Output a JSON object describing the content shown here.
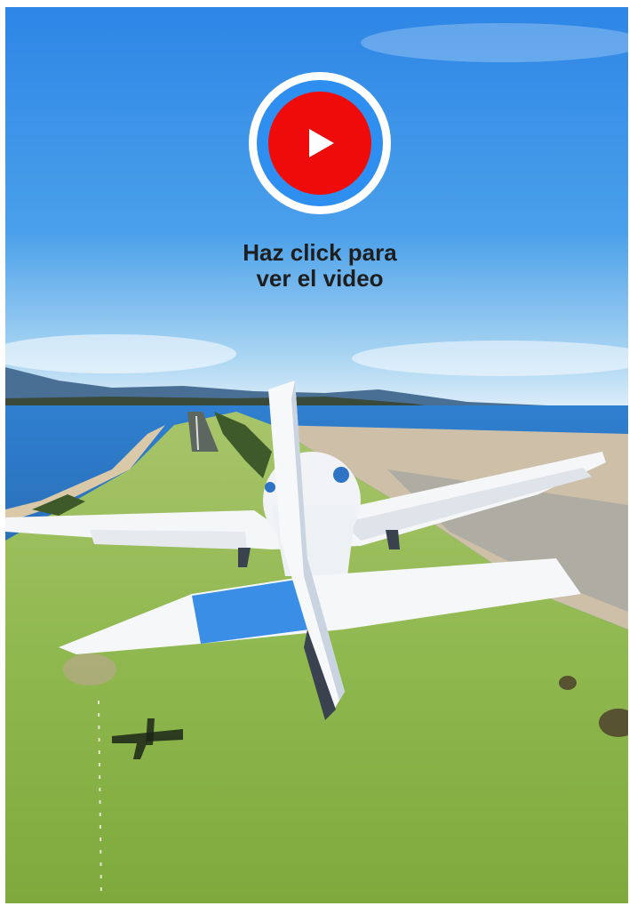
{
  "video": {
    "caption_line1": "Haz click para",
    "caption_line2": "ver el video",
    "play_icon": "play-icon",
    "colors": {
      "play_red": "#f00b0b",
      "ring_blue": "#2f8ff0",
      "ring_white": "#ffffff",
      "caption": "#1e1e1e"
    }
  }
}
